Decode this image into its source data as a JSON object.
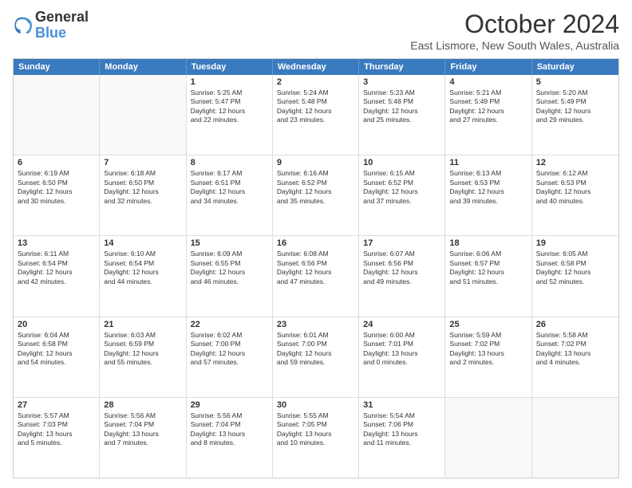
{
  "logo": {
    "line1": "General",
    "line2": "Blue"
  },
  "title": "October 2024",
  "location": "East Lismore, New South Wales, Australia",
  "days_of_week": [
    "Sunday",
    "Monday",
    "Tuesday",
    "Wednesday",
    "Thursday",
    "Friday",
    "Saturday"
  ],
  "weeks": [
    [
      {
        "day": "",
        "text": "",
        "empty": true
      },
      {
        "day": "",
        "text": "",
        "empty": true
      },
      {
        "day": "1",
        "text": "Sunrise: 5:25 AM\nSunset: 5:47 PM\nDaylight: 12 hours\nand 22 minutes."
      },
      {
        "day": "2",
        "text": "Sunrise: 5:24 AM\nSunset: 5:48 PM\nDaylight: 12 hours\nand 23 minutes."
      },
      {
        "day": "3",
        "text": "Sunrise: 5:23 AM\nSunset: 5:48 PM\nDaylight: 12 hours\nand 25 minutes."
      },
      {
        "day": "4",
        "text": "Sunrise: 5:21 AM\nSunset: 5:49 PM\nDaylight: 12 hours\nand 27 minutes."
      },
      {
        "day": "5",
        "text": "Sunrise: 5:20 AM\nSunset: 5:49 PM\nDaylight: 12 hours\nand 29 minutes."
      }
    ],
    [
      {
        "day": "6",
        "text": "Sunrise: 6:19 AM\nSunset: 6:50 PM\nDaylight: 12 hours\nand 30 minutes."
      },
      {
        "day": "7",
        "text": "Sunrise: 6:18 AM\nSunset: 6:50 PM\nDaylight: 12 hours\nand 32 minutes."
      },
      {
        "day": "8",
        "text": "Sunrise: 6:17 AM\nSunset: 6:51 PM\nDaylight: 12 hours\nand 34 minutes."
      },
      {
        "day": "9",
        "text": "Sunrise: 6:16 AM\nSunset: 6:52 PM\nDaylight: 12 hours\nand 35 minutes."
      },
      {
        "day": "10",
        "text": "Sunrise: 6:15 AM\nSunset: 6:52 PM\nDaylight: 12 hours\nand 37 minutes."
      },
      {
        "day": "11",
        "text": "Sunrise: 6:13 AM\nSunset: 6:53 PM\nDaylight: 12 hours\nand 39 minutes."
      },
      {
        "day": "12",
        "text": "Sunrise: 6:12 AM\nSunset: 6:53 PM\nDaylight: 12 hours\nand 40 minutes."
      }
    ],
    [
      {
        "day": "13",
        "text": "Sunrise: 6:11 AM\nSunset: 6:54 PM\nDaylight: 12 hours\nand 42 minutes."
      },
      {
        "day": "14",
        "text": "Sunrise: 6:10 AM\nSunset: 6:54 PM\nDaylight: 12 hours\nand 44 minutes."
      },
      {
        "day": "15",
        "text": "Sunrise: 6:09 AM\nSunset: 6:55 PM\nDaylight: 12 hours\nand 46 minutes."
      },
      {
        "day": "16",
        "text": "Sunrise: 6:08 AM\nSunset: 6:56 PM\nDaylight: 12 hours\nand 47 minutes."
      },
      {
        "day": "17",
        "text": "Sunrise: 6:07 AM\nSunset: 6:56 PM\nDaylight: 12 hours\nand 49 minutes."
      },
      {
        "day": "18",
        "text": "Sunrise: 6:06 AM\nSunset: 6:57 PM\nDaylight: 12 hours\nand 51 minutes."
      },
      {
        "day": "19",
        "text": "Sunrise: 6:05 AM\nSunset: 6:58 PM\nDaylight: 12 hours\nand 52 minutes."
      }
    ],
    [
      {
        "day": "20",
        "text": "Sunrise: 6:04 AM\nSunset: 6:58 PM\nDaylight: 12 hours\nand 54 minutes."
      },
      {
        "day": "21",
        "text": "Sunrise: 6:03 AM\nSunset: 6:59 PM\nDaylight: 12 hours\nand 55 minutes."
      },
      {
        "day": "22",
        "text": "Sunrise: 6:02 AM\nSunset: 7:00 PM\nDaylight: 12 hours\nand 57 minutes."
      },
      {
        "day": "23",
        "text": "Sunrise: 6:01 AM\nSunset: 7:00 PM\nDaylight: 12 hours\nand 59 minutes."
      },
      {
        "day": "24",
        "text": "Sunrise: 6:00 AM\nSunset: 7:01 PM\nDaylight: 13 hours\nand 0 minutes."
      },
      {
        "day": "25",
        "text": "Sunrise: 5:59 AM\nSunset: 7:02 PM\nDaylight: 13 hours\nand 2 minutes."
      },
      {
        "day": "26",
        "text": "Sunrise: 5:58 AM\nSunset: 7:02 PM\nDaylight: 13 hours\nand 4 minutes."
      }
    ],
    [
      {
        "day": "27",
        "text": "Sunrise: 5:57 AM\nSunset: 7:03 PM\nDaylight: 13 hours\nand 5 minutes."
      },
      {
        "day": "28",
        "text": "Sunrise: 5:56 AM\nSunset: 7:04 PM\nDaylight: 13 hours\nand 7 minutes."
      },
      {
        "day": "29",
        "text": "Sunrise: 5:56 AM\nSunset: 7:04 PM\nDaylight: 13 hours\nand 8 minutes."
      },
      {
        "day": "30",
        "text": "Sunrise: 5:55 AM\nSunset: 7:05 PM\nDaylight: 13 hours\nand 10 minutes."
      },
      {
        "day": "31",
        "text": "Sunrise: 5:54 AM\nSunset: 7:06 PM\nDaylight: 13 hours\nand 11 minutes."
      },
      {
        "day": "",
        "text": "",
        "empty": true
      },
      {
        "day": "",
        "text": "",
        "empty": true
      }
    ]
  ]
}
